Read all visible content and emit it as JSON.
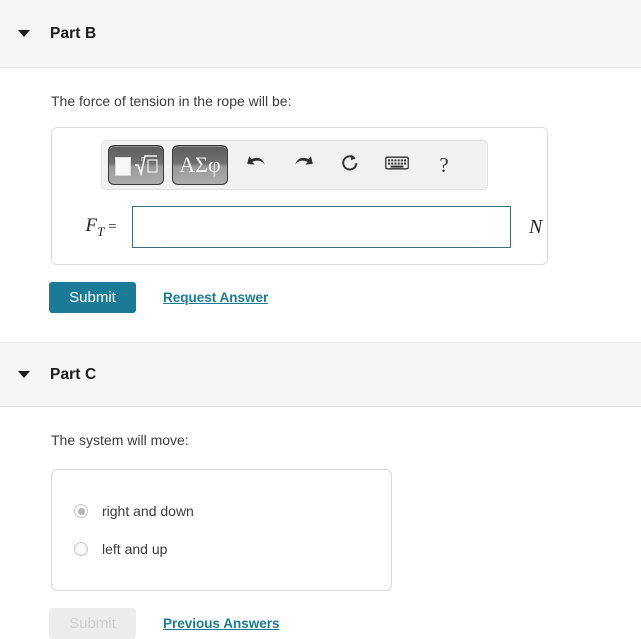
{
  "parts": [
    {
      "id": "part-b",
      "title": "Part B",
      "caret_icon": "chevron-down-icon",
      "prompt": "The force of tension in the rope will be:",
      "math_toolbar": {
        "buttons": [
          {
            "name": "template-radical-button",
            "icon": "square-root-template-icon",
            "label": ""
          },
          {
            "name": "greek-symbols-button",
            "icon": "greek-letters-icon",
            "label": "ΑΣφ"
          },
          {
            "name": "undo-button",
            "icon": "undo-arrow-icon",
            "label": ""
          },
          {
            "name": "redo-button",
            "icon": "redo-arrow-icon",
            "label": ""
          },
          {
            "name": "reset-button",
            "icon": "refresh-circle-icon",
            "label": ""
          },
          {
            "name": "keyboard-button",
            "icon": "keyboard-icon",
            "label": ""
          },
          {
            "name": "help-button",
            "icon": "question-mark-icon",
            "label": "?"
          }
        ]
      },
      "answer": {
        "variable": "F",
        "subscript": "T",
        "equals": "=",
        "value": "",
        "placeholder": "",
        "unit": "N"
      },
      "actions": {
        "submit_label": "Submit",
        "submit_disabled": false,
        "link_label": "Request Answer"
      }
    },
    {
      "id": "part-c",
      "title": "Part C",
      "caret_icon": "chevron-down-icon",
      "prompt": "The system will move:",
      "choices": [
        {
          "label": "right and down",
          "selected": true
        },
        {
          "label": "left and up",
          "selected": false
        }
      ],
      "actions": {
        "submit_label": "Submit",
        "submit_disabled": true,
        "link_label": "Previous Answers"
      }
    }
  ],
  "colors": {
    "accent_teal": "#1b7b96",
    "input_border": "#3c6e7d",
    "header_band": "#f6f6f6",
    "disabled_button_bg": "#ececec",
    "disabled_button_text": "#cfcfcf"
  }
}
